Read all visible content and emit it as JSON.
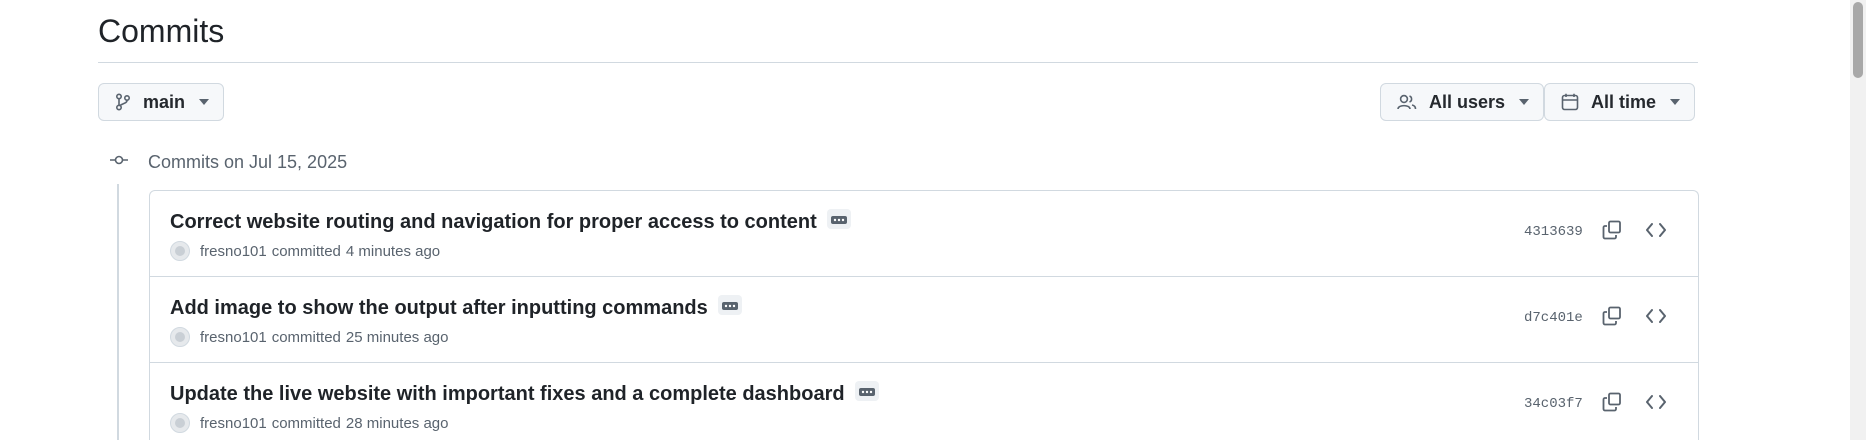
{
  "page": {
    "title": "Commits"
  },
  "toolbar": {
    "branch_label": "main",
    "users_label": "All users",
    "time_label": "All time"
  },
  "timeline": {
    "date_heading": "Commits on Jul 15, 2025"
  },
  "commits": [
    {
      "message": "Correct website routing and navigation for proper access to content",
      "author": "fresno101",
      "action": "committed",
      "time": "4 minutes ago",
      "sha": "4313639"
    },
    {
      "message": "Add image to show the output after inputting commands",
      "author": "fresno101",
      "action": "committed",
      "time": "25 minutes ago",
      "sha": "d7c401e"
    },
    {
      "message": "Update the live website with important fixes and a complete dashboard",
      "author": "fresno101",
      "action": "committed",
      "time": "28 minutes ago",
      "sha": "34c03f7"
    }
  ],
  "icons": {
    "branch": "git-branch-icon",
    "users": "people-icon",
    "time": "calendar-icon",
    "caret": "triangle-down-icon",
    "commit": "git-commit-icon",
    "ellipsis": "kebab-horizontal-icon",
    "copy": "copy-icon",
    "browse": "code-icon"
  },
  "colors": {
    "text": "#1f2328",
    "muted": "#59636e",
    "border": "#d1d9e0",
    "button_bg": "#f6f8fa"
  }
}
